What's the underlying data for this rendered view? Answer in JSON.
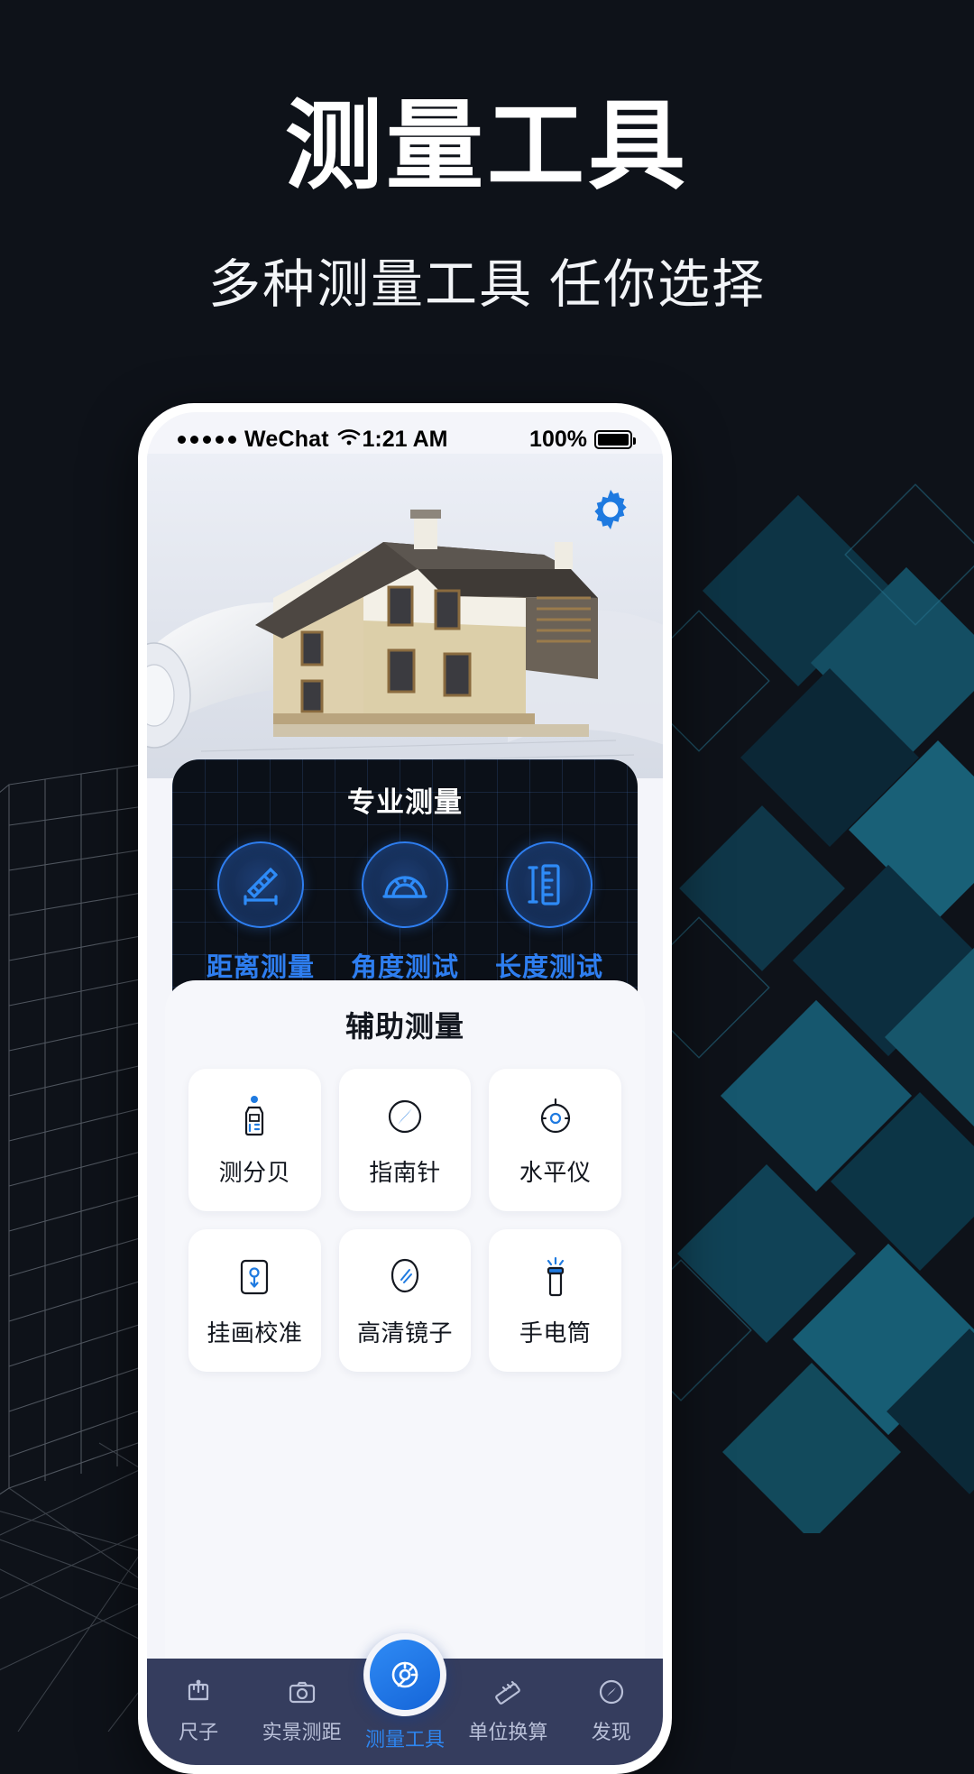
{
  "hero": {
    "title": "测量工具",
    "subtitle": "多种测量工具 任你选择"
  },
  "colors": {
    "background": "#0e1219",
    "accent_blue": "#2e7ef0",
    "tabbar_bg": "#353d5e",
    "pro_card_bg": "#0b1018",
    "aux_card_bg": "#f6f7fb"
  },
  "phone": {
    "statusbar": {
      "carrier": "WeChat",
      "signal_icon": "signal-dots-icon",
      "wifi_icon": "wifi-icon",
      "time": "1:21 AM",
      "battery_percent": "100%",
      "battery_icon": "battery-full-icon"
    },
    "photo": {
      "alt": "house-3d-blueprint-image",
      "settings_icon": "gear-icon"
    },
    "pro_section": {
      "title": "专业测量",
      "items": [
        {
          "label": "距离测量",
          "icon": "ruler-diagonal-icon"
        },
        {
          "label": "角度测试",
          "icon": "protractor-icon"
        },
        {
          "label": "长度测试",
          "icon": "ruler-vertical-icon"
        }
      ]
    },
    "aux_section": {
      "title": "辅助测量",
      "items": [
        {
          "label": "测分贝",
          "icon": "decibel-meter-icon"
        },
        {
          "label": "指南针",
          "icon": "compass-icon"
        },
        {
          "label": "水平仪",
          "icon": "spirit-level-icon"
        },
        {
          "label": "挂画校准",
          "icon": "picture-align-icon"
        },
        {
          "label": "高清镜子",
          "icon": "mirror-icon"
        },
        {
          "label": "手电筒",
          "icon": "flashlight-icon"
        }
      ]
    },
    "tabbar": {
      "items": [
        {
          "label": "尺子",
          "icon": "ruler-tab-icon",
          "active": false
        },
        {
          "label": "实景测距",
          "icon": "camera-tab-icon",
          "active": false
        },
        {
          "label": "测量工具",
          "icon": "measure-tools-tab-icon",
          "active": true
        },
        {
          "label": "单位换算",
          "icon": "unit-convert-tab-icon",
          "active": false
        },
        {
          "label": "发现",
          "icon": "discover-tab-icon",
          "active": false
        }
      ]
    }
  }
}
